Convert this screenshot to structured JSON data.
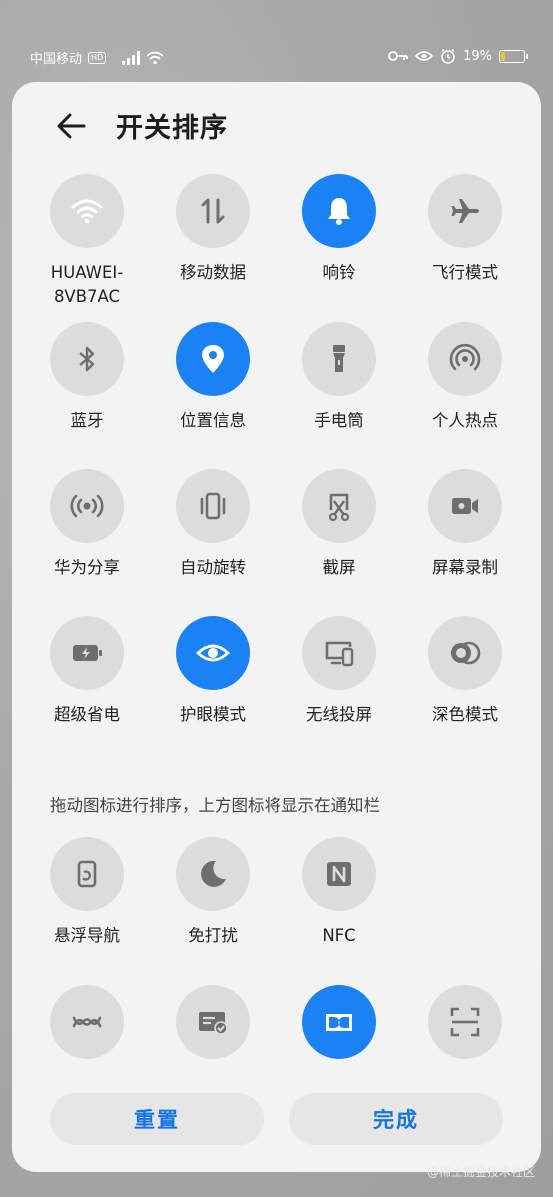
{
  "status_bar": {
    "carrier": "中国移动",
    "network_badge": "HD",
    "battery_percent": "19%",
    "battery_level": 0.19,
    "icons": [
      "signal-icon",
      "wifi-icon",
      "key-icon",
      "eye-icon",
      "alarm-icon",
      "battery-icon"
    ]
  },
  "header": {
    "title": "开关排序",
    "back_icon": "arrow-left-icon"
  },
  "active_tiles": {
    "tiles": [
      {
        "label": "HUAWEI-8VB7AC",
        "label_line1": "HUAWEI-",
        "label_line2": "8VB7AC",
        "icon": "wifi-icon",
        "active": true
      },
      {
        "label": "移动数据",
        "icon": "mobile-data-icon",
        "active": false
      },
      {
        "label": "响铃",
        "icon": "bell-icon",
        "active": true
      },
      {
        "label": "飞行模式",
        "icon": "airplane-icon",
        "active": false
      },
      {
        "label": "蓝牙",
        "icon": "bluetooth-icon",
        "active": false
      },
      {
        "label": "位置信息",
        "icon": "location-icon",
        "active": true
      },
      {
        "label": "手电筒",
        "icon": "flashlight-icon",
        "active": false
      },
      {
        "label": "个人热点",
        "icon": "hotspot-icon",
        "active": false
      },
      {
        "label": "华为分享",
        "icon": "share-icon",
        "active": false
      },
      {
        "label": "自动旋转",
        "icon": "auto-rotate-icon",
        "active": false
      },
      {
        "label": "截屏",
        "icon": "screenshot-icon",
        "active": false
      },
      {
        "label": "屏幕录制",
        "icon": "screen-record-icon",
        "active": false
      },
      {
        "label": "超级省电",
        "icon": "battery-saver-icon",
        "active": false
      },
      {
        "label": "护眼模式",
        "icon": "eye-comfort-icon",
        "active": true
      },
      {
        "label": "无线投屏",
        "icon": "wireless-projection-icon",
        "active": false
      },
      {
        "label": "深色模式",
        "icon": "dark-mode-icon",
        "active": false
      }
    ]
  },
  "hint": "拖动图标进行排序，上方图标将显示在通知栏",
  "inactive_tiles": {
    "tiles": [
      {
        "label": "悬浮导航",
        "icon": "floating-nav-icon",
        "active": false
      },
      {
        "label": "免打扰",
        "icon": "moon-icon",
        "active": false
      },
      {
        "label": "NFC",
        "icon": "nfc-icon",
        "active": false
      },
      {
        "label": "",
        "icon": "link-icon",
        "active": false
      },
      {
        "label": "",
        "icon": "card-check-icon",
        "active": false
      },
      {
        "label": "",
        "icon": "dolby-icon",
        "active": true
      },
      {
        "label": "",
        "icon": "scan-icon",
        "active": false
      }
    ]
  },
  "buttons": {
    "reset": "重置",
    "done": "完成"
  },
  "watermark": "@稀土掘金技术社区",
  "colors": {
    "accent": "#1a82f5",
    "tile_off": "#dcdcdc",
    "panel": "#f3f3f3",
    "button_text": "#1473e6"
  }
}
